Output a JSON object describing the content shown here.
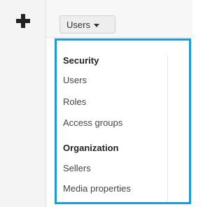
{
  "toolbar": {
    "add_icon": "plus-icon",
    "users_button_label": "Users",
    "users_button_icon": "caret-down-icon"
  },
  "menu": {
    "sections": [
      {
        "header": "Security",
        "items": [
          "Users",
          "Roles",
          "Access groups"
        ]
      },
      {
        "header": "Organization",
        "items": [
          "Sellers",
          "Media properties"
        ]
      }
    ]
  },
  "colors": {
    "accent_border": "#1a9be0",
    "rail_background": "#f4f4f4"
  }
}
